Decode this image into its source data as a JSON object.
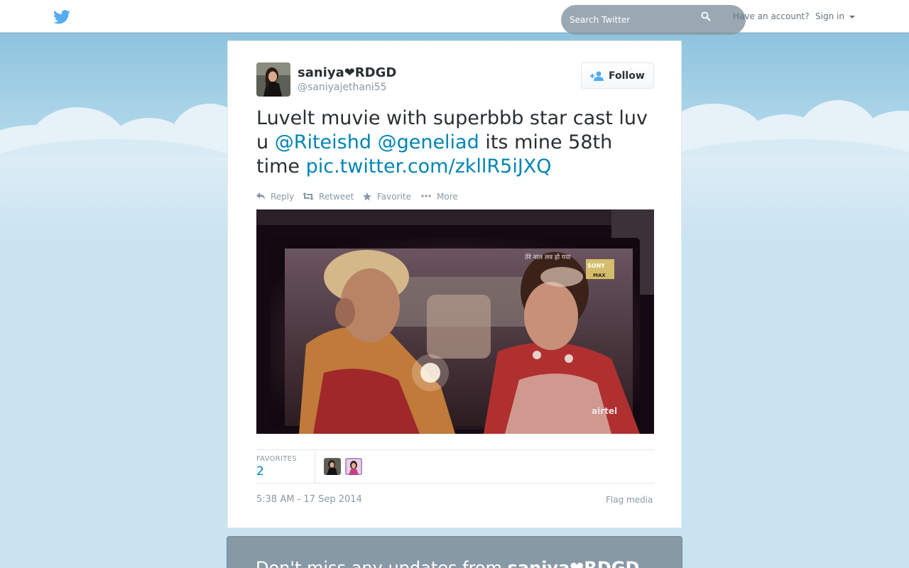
{
  "header": {
    "search_placeholder": "Search Twitter",
    "have_account": "Have an account?",
    "sign_in": "Sign in"
  },
  "tweet": {
    "fullname": "saniya❤RDGD",
    "username": "@saniyajethani55",
    "follow_label": "Follow",
    "text_parts": {
      "p1": "Luvelt muvie with superbbb star cast luv u ",
      "mention1": "@Riteishd",
      "space1": " ",
      "mention2": "@geneliad",
      "p2": " its mine 58th time ",
      "link": "pic.twitter.com/zkllR5iJXQ"
    },
    "actions": {
      "reply": "Reply",
      "retweet": "Retweet",
      "favorite": "Favorite",
      "more": "More"
    },
    "photo_text": {
      "caption": "तेरे नाल लव हो गया",
      "channel_top": "SONY",
      "channel_bottom": "MAX",
      "brand": "airtel"
    },
    "favorites_label": "FAVORITES",
    "favorites_count": "2",
    "timestamp": "5:38 AM - 17 Sep 2014",
    "flag_media": "Flag media"
  },
  "signup": {
    "prefix": "Don't miss any updates from ",
    "name": "saniya❤RDGD"
  },
  "colors": {
    "link": "#0084b4",
    "twitter_blue": "#55acee",
    "sky": "#c0deed"
  },
  "icons": [
    "twitter-bird-icon",
    "search-icon",
    "follow-person-icon",
    "reply-icon",
    "retweet-icon",
    "star-icon",
    "more-dots-icon"
  ]
}
